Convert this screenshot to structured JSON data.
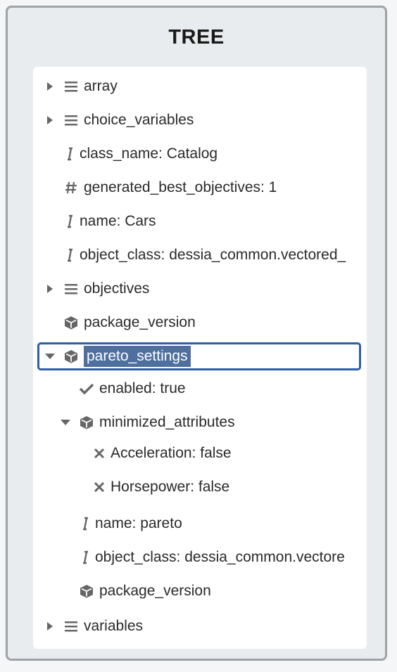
{
  "panel": {
    "title": "TREE"
  },
  "tree": {
    "rows": [
      {
        "label": "array",
        "icon": "list-icon",
        "caret": "right"
      },
      {
        "label": "choice_variables",
        "icon": "list-icon",
        "caret": "right"
      },
      {
        "label": "class_name: Catalog",
        "icon": "text-icon",
        "caret": "none"
      },
      {
        "label": "generated_best_objectives: 1",
        "icon": "hash-icon",
        "caret": "none"
      },
      {
        "label": "name: Cars",
        "icon": "text-icon",
        "caret": "none"
      },
      {
        "label": "object_class: dessia_common.vectored_",
        "icon": "text-icon",
        "caret": "none"
      },
      {
        "label": "objectives",
        "icon": "list-icon",
        "caret": "right"
      },
      {
        "label": "package_version",
        "icon": "cube-icon",
        "caret": "none"
      },
      {
        "label": "pareto_settings",
        "icon": "cube-icon",
        "caret": "down",
        "selected": true
      },
      {
        "label": "enabled: true",
        "icon": "check-icon",
        "caret": "none"
      },
      {
        "label": "minimized_attributes",
        "icon": "cube-icon",
        "caret": "down"
      },
      {
        "label": "Acceleration: false",
        "icon": "x-icon",
        "caret": "none"
      },
      {
        "label": "Horsepower: false",
        "icon": "x-icon",
        "caret": "none"
      },
      {
        "label": "name: pareto",
        "icon": "text-icon",
        "caret": "none"
      },
      {
        "label": "object_class: dessia_common.vectore",
        "icon": "text-icon",
        "caret": "none"
      },
      {
        "label": "package_version",
        "icon": "cube-icon",
        "caret": "none"
      },
      {
        "label": "variables",
        "icon": "list-icon",
        "caret": "right"
      }
    ]
  },
  "colors": {
    "selection_bg": "#4f6f9f",
    "selection_border": "#2f5ea6"
  }
}
